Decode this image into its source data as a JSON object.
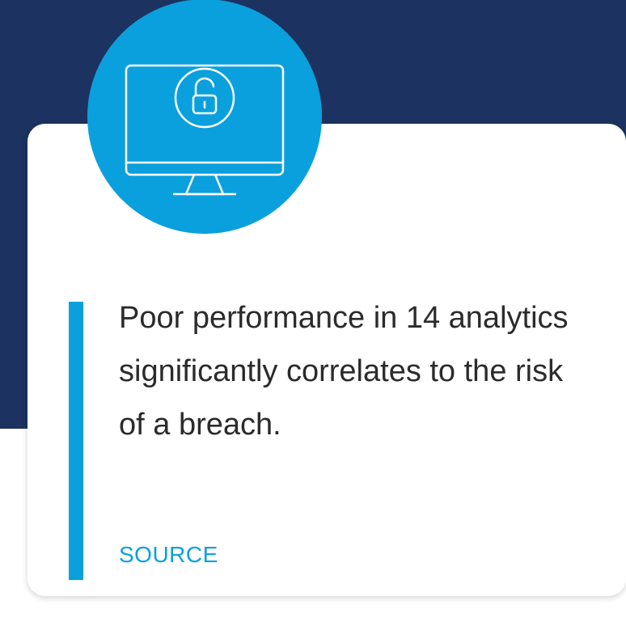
{
  "card": {
    "quote": "Poor performance in 14 analytics significantly correlates to the risk of a breach.",
    "source_label": "SOURCE"
  },
  "icon": {
    "name": "monitor-unlocked-padlock-icon"
  },
  "colors": {
    "background_band": "#1c3260",
    "accent": "#0aa0dd",
    "card": "#ffffff",
    "text": "#2b2b2b"
  }
}
